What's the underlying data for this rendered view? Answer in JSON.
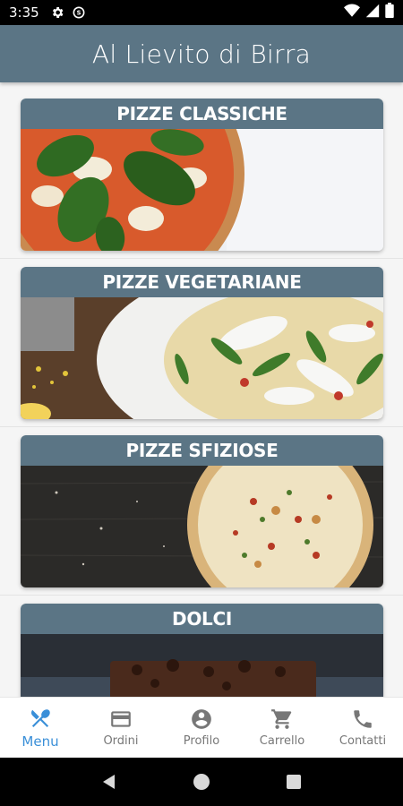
{
  "status_bar": {
    "time": "3:35",
    "icons": [
      "settings-icon",
      "data-saver-icon",
      "wifi-icon",
      "signal-icon",
      "battery-icon"
    ]
  },
  "app_bar": {
    "title": "Al Lievito di Birra"
  },
  "categories": [
    {
      "label": "PIZZE CLASSICHE",
      "image": "margherita-pizza-photo"
    },
    {
      "label": "PIZZE VEGETARIANE",
      "image": "vegetarian-pizza-photo"
    },
    {
      "label": "PIZZE SFIZIOSE",
      "image": "special-pizza-photo"
    },
    {
      "label": "DOLCI",
      "image": "brownie-dessert-photo"
    }
  ],
  "bottom_nav": {
    "active_index": 0,
    "items": [
      {
        "label": "Menu",
        "icon": "fork-spoon-icon"
      },
      {
        "label": "Ordini",
        "icon": "credit-card-icon"
      },
      {
        "label": "Profilo",
        "icon": "account-circle-icon"
      },
      {
        "label": "Carrello",
        "icon": "shopping-cart-icon"
      },
      {
        "label": "Contatti",
        "icon": "phone-icon"
      }
    ]
  },
  "colors": {
    "primary": "#5b7585",
    "active_nav": "#3a8fd8",
    "inactive_nav": "#777777",
    "background": "#f5f5f5"
  }
}
